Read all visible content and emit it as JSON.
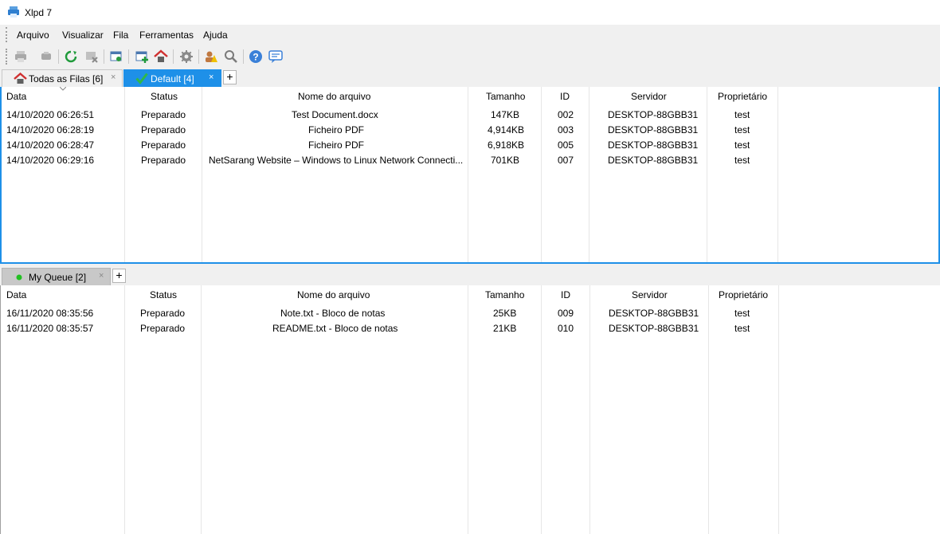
{
  "window": {
    "title": "Xlpd 7"
  },
  "menu": [
    "Arquivo",
    "Visualizar",
    "Fila",
    "Ferramentas",
    "Ajuda"
  ],
  "toolbar": {
    "icons": [
      "print-icon",
      "print-preview-icon",
      "refresh-icon",
      "delete-job-icon",
      "queue-settings-icon",
      "add-queue-icon",
      "home-queue-icon",
      "settings-gear-icon",
      "alert-user-icon",
      "search-icon",
      "help-icon",
      "feedback-icon"
    ]
  },
  "top_tabs": [
    {
      "label": "Todas as Filas [6]",
      "icon": "house-icon",
      "active": false
    },
    {
      "label": "Default [4]",
      "icon": "check-icon",
      "active": true
    }
  ],
  "bottom_tabs": [
    {
      "label": "My Queue [2]",
      "icon": "status-dot-icon",
      "active": false
    }
  ],
  "columns": [
    "Data",
    "Status",
    "Nome do arquivo",
    "Tamanho",
    "ID",
    "Servidor",
    "Proprietário"
  ],
  "top_rows": [
    [
      "14/10/2020 06:26:51",
      "Preparado",
      "Test Document.docx",
      "147KB",
      "002",
      "DESKTOP-88GBB31",
      "test"
    ],
    [
      "14/10/2020 06:28:19",
      "Preparado",
      "Ficheiro PDF",
      "4,914KB",
      "003",
      "DESKTOP-88GBB31",
      "test"
    ],
    [
      "14/10/2020 06:28:47",
      "Preparado",
      "Ficheiro PDF",
      "6,918KB",
      "005",
      "DESKTOP-88GBB31",
      "test"
    ],
    [
      "14/10/2020 06:29:16",
      "Preparado",
      "NetSarang Website – Windows to Linux Network Connecti...",
      "701KB",
      "007",
      "DESKTOP-88GBB31",
      "test"
    ]
  ],
  "bottom_rows": [
    [
      "16/11/2020 08:35:56",
      "Preparado",
      "Note.txt - Bloco de notas",
      "25KB",
      "009",
      "DESKTOP-88GBB31",
      "test"
    ],
    [
      "16/11/2020 08:35:57",
      "Preparado",
      "README.txt - Bloco de notas",
      "21KB",
      "010",
      "DESKTOP-88GBB31",
      "test"
    ]
  ],
  "colors": {
    "accent": "#1e90e8",
    "status_dot": "#22c022"
  }
}
